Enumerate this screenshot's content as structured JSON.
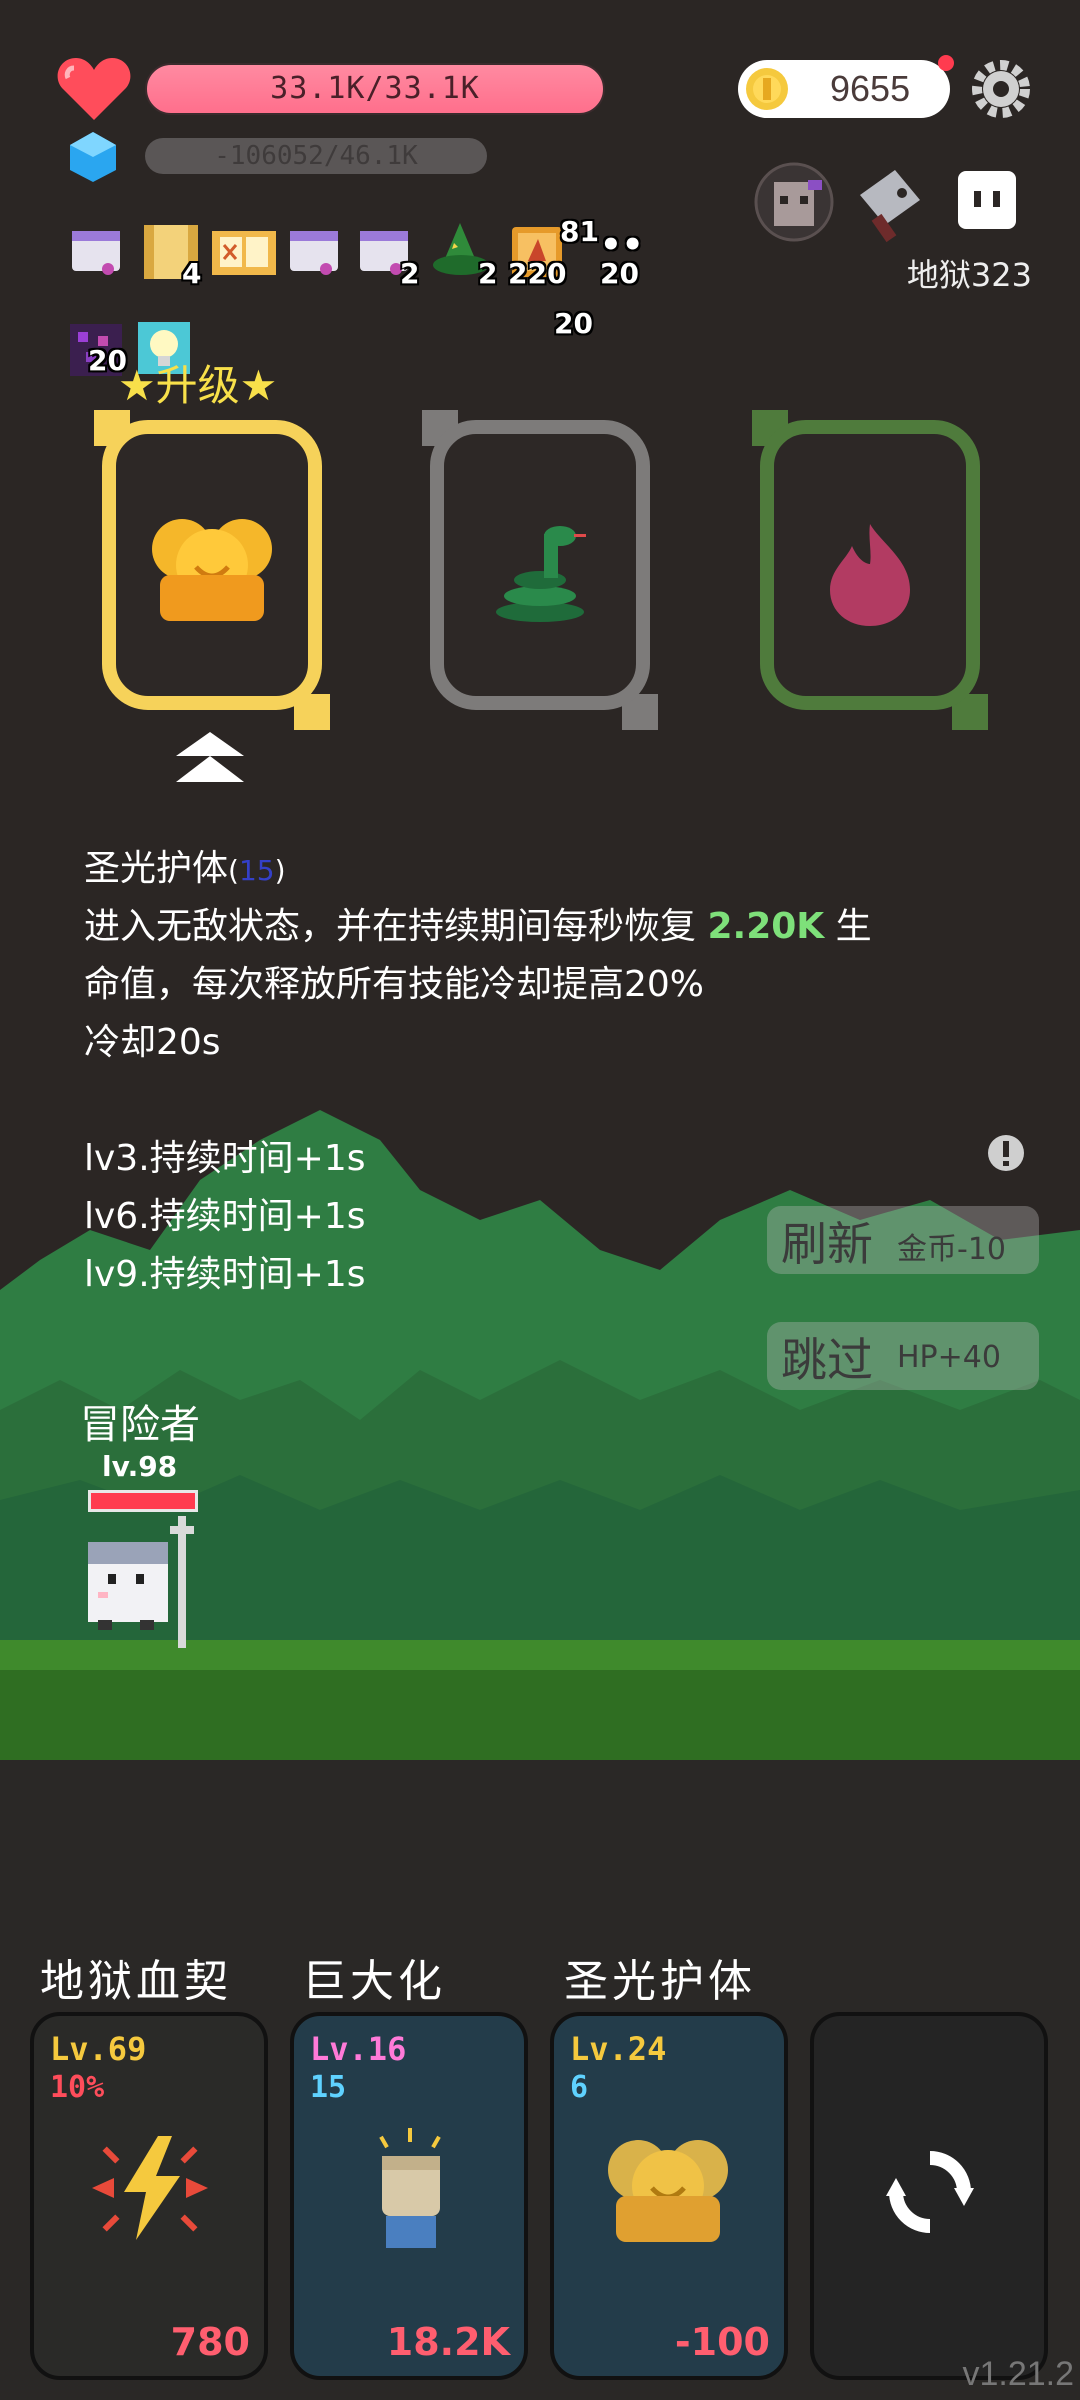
{
  "hud": {
    "hp_text": "33.1K/33.1K",
    "xp_text": "-106052/46.1K",
    "coins": "9655",
    "stage": "地狱323"
  },
  "items": [
    {
      "icon": "scroll-icon",
      "count": ""
    },
    {
      "icon": "map-icon",
      "count": "4"
    },
    {
      "icon": "book-icon",
      "count": ""
    },
    {
      "icon": "scroll-icon",
      "count": ""
    },
    {
      "icon": "scroll-icon",
      "count": "2"
    },
    {
      "icon": "witch-hat-icon",
      "count": "2"
    },
    {
      "icon": "spellbook-icon",
      "count": "220"
    },
    {
      "icon": "dots-icon",
      "count": "20"
    }
  ],
  "items_extra": {
    "top": "81",
    "below": "20",
    "gem": "20"
  },
  "upgrade": {
    "title": "★升级★"
  },
  "skill": {
    "name": "圣光护体",
    "level_tag": "15",
    "line1_prefix": "进入无敌状态，并在持续期间每秒恢复",
    "line1_value": "2.20K",
    "line1_suffix": "生",
    "line2": "命值，每次释放所有技能冷却提高20%",
    "line3": "冷却20s",
    "lv3": "lv3.持续时间+1s",
    "lv6": "lv6.持续时间+1s",
    "lv9": "lv9.持续时间+1s"
  },
  "buttons": {
    "refresh_main": "刷新",
    "refresh_sub": "金币-10",
    "skip_main": "跳过",
    "skip_sub": "HP+40"
  },
  "hero": {
    "name": "冒险者",
    "level": "lv.98"
  },
  "skills_bar": [
    {
      "label": "地狱血契",
      "lv": "Lv.69",
      "sub": "10%",
      "cost": "780"
    },
    {
      "label": "巨大化",
      "lv": "Lv.16",
      "sub": "15",
      "cost": "18.2K"
    },
    {
      "label": "圣光护体",
      "lv": "Lv.24",
      "sub": "6",
      "cost": "-100"
    }
  ],
  "version": "v1.21.2",
  "colors": {
    "hp": "#ff7490",
    "gold": "#f5c93e",
    "card_gray": "#7d7b7a",
    "card_green": "#4f7b3c"
  }
}
